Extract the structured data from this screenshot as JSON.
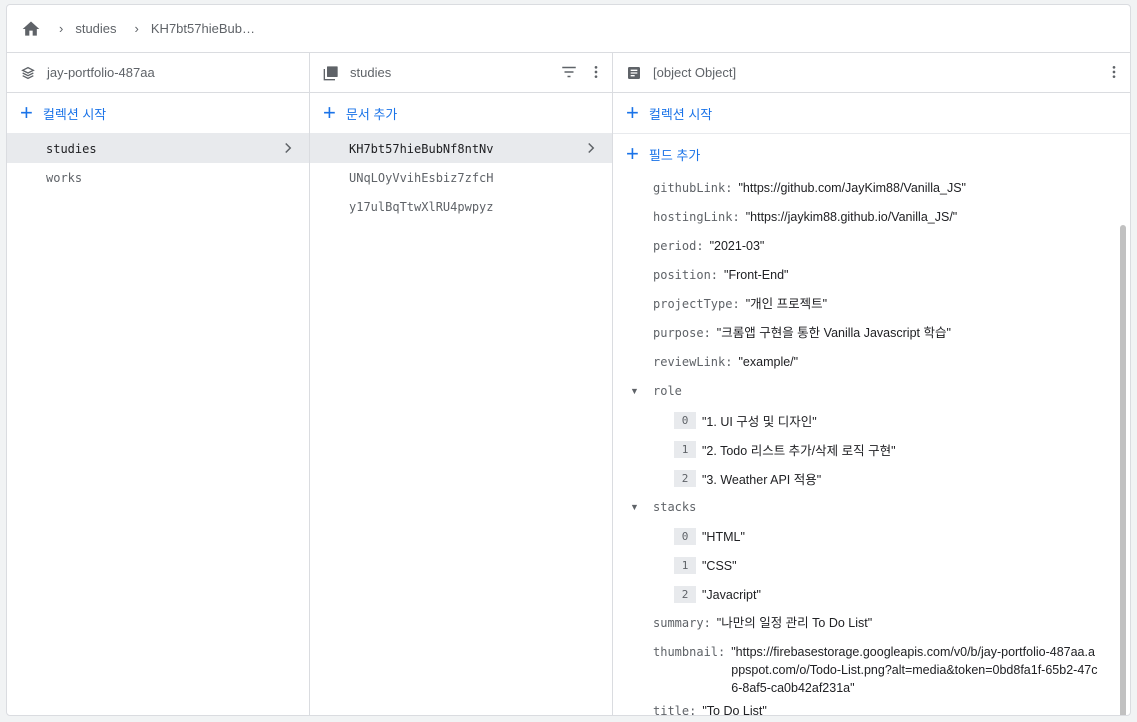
{
  "breadcrumb": {
    "items": [
      "studies",
      "KH7bt57hieBub…"
    ]
  },
  "project_column": {
    "title": "jay-portfolio-487aa",
    "add_label": "컬렉션 시작",
    "collections": [
      {
        "label": "studies",
        "selected": true
      },
      {
        "label": "works",
        "selected": false
      }
    ]
  },
  "collection_column": {
    "title": "studies",
    "add_label": "문서 추가",
    "documents": [
      {
        "label": "KH7bt57hieBubNf8ntNv",
        "selected": true
      },
      {
        "label": "UNqLOyVvihEsbiz7zfcH",
        "selected": false
      },
      {
        "label": "y17ulBqTtwXlRU4pwpyz",
        "selected": false
      }
    ]
  },
  "document_column": {
    "title": {
      "key": "title:",
      "value": "\"To Do List\""
    },
    "add_collection_label": "컬렉션 시작",
    "add_field_label": "필드 추가",
    "fields": [
      {
        "key": "githubLink:",
        "value": "\"https://github.com/JayKim88/Vanilla_JS\""
      },
      {
        "key": "hostingLink:",
        "value": "\"https://jaykim88.github.io/Vanilla_JS/\""
      },
      {
        "key": "period:",
        "value": "\"2021-03\""
      },
      {
        "key": "position:",
        "value": "\"Front-End\""
      },
      {
        "key": "projectType:",
        "value": "\"개인 프로젝트\""
      },
      {
        "key": "purpose:",
        "value": "\"크롬앱 구현을 통한 Vanilla Javascript 학습\""
      },
      {
        "key": "reviewLink:",
        "value": "\"example/\""
      }
    ],
    "role": {
      "key": "role",
      "items": [
        {
          "index": "0",
          "value": "\"1. UI 구성 및 디자인\""
        },
        {
          "index": "1",
          "value": "\"2. Todo 리스트 추가/삭제 로직 구현\""
        },
        {
          "index": "2",
          "value": "\"3. Weather API 적용\""
        }
      ]
    },
    "stacks": {
      "key": "stacks",
      "items": [
        {
          "index": "0",
          "value": "\"HTML\""
        },
        {
          "index": "1",
          "value": "\"CSS\""
        },
        {
          "index": "2",
          "value": "\"Javacript\""
        }
      ]
    },
    "summary": {
      "key": "summary:",
      "value": "\"나만의 일정 관리 To Do List\""
    },
    "thumbnail": {
      "key": "thumbnail:",
      "value": "\"https://firebasestorage.googleapis.com/v0/b/jay-portfolio-487aa.appspot.com/o/Todo-List.png?alt=media&token=0bd8fa1f-65b2-47c6-8af5-ca0b42af231a\""
    }
  },
  "colors": {
    "accent": "#1a73e8",
    "selected_bg": "#e8eaed",
    "border": "#dadce0"
  }
}
